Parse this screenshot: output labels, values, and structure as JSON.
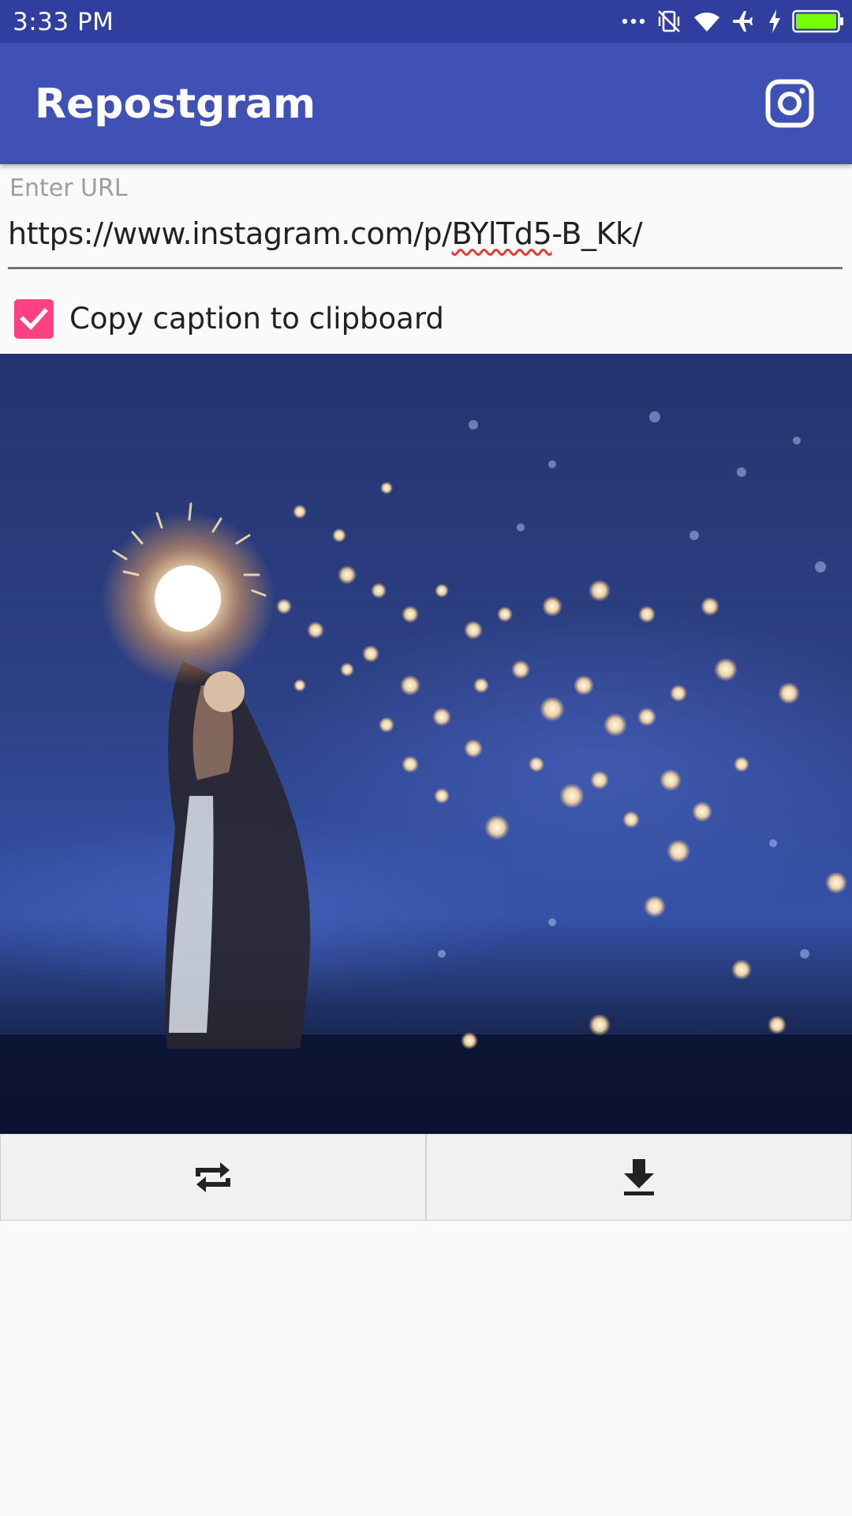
{
  "status_bar": {
    "time": "3:33  PM",
    "icons": [
      "more-dots-icon",
      "vibrate-off-icon",
      "wifi-icon",
      "airplane-icon",
      "charging-bolt-icon",
      "battery-icon"
    ],
    "battery_color": "#76ff03"
  },
  "app_bar": {
    "title": "Repostgram",
    "action_icon": "instagram-icon",
    "color": "#3f51b5"
  },
  "url_field": {
    "label": "Enter URL",
    "value_prefix": "https://www.instagram.com/p/",
    "value_flagged": "BYlTd5",
    "value_suffix": "-B_Kk/"
  },
  "caption_option": {
    "label": "Copy caption to clipboard",
    "checked": true,
    "accent": "#ff4081"
  },
  "actions": {
    "repost_icon": "repost-icon",
    "download_icon": "download-icon"
  }
}
